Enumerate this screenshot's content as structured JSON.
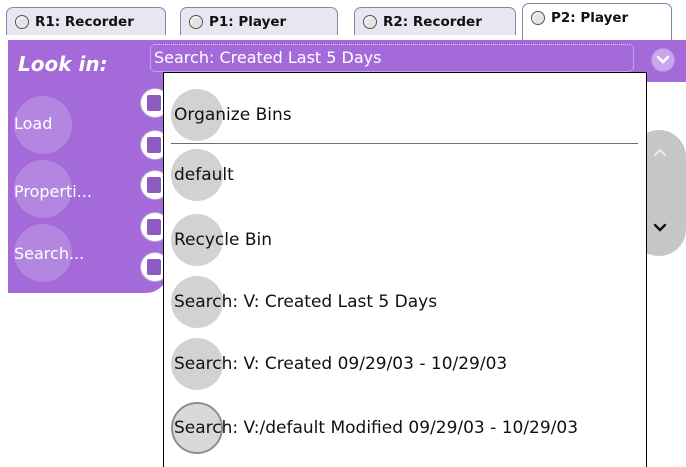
{
  "tabs": [
    {
      "label": "R1: Recorder",
      "active": false
    },
    {
      "label": "P1: Player",
      "active": false
    },
    {
      "label": "R2: Recorder",
      "active": false
    },
    {
      "label": "P2: Player",
      "active": true
    }
  ],
  "look_in": {
    "label": "Look in:",
    "value": "Search: Created Last 5 Days"
  },
  "side_buttons": [
    {
      "label": "Load"
    },
    {
      "label": "Properti..."
    },
    {
      "label": "Search..."
    }
  ],
  "dropdown": {
    "items": [
      {
        "label": "Organize Bins"
      },
      {
        "label": "default"
      },
      {
        "label": "Recycle Bin"
      },
      {
        "label": "Search: V: Created Last 5 Days"
      },
      {
        "label": "Search: V: Created 09/29/03 - 10/29/03"
      },
      {
        "label": "Search: V:/default Modified 09/29/03 - 10/29/03"
      }
    ]
  },
  "colors": {
    "panel_purple": "#a56ad9",
    "tab_background": "#e9e6f2",
    "list_bubble": "#d2d2d2"
  },
  "icons": [
    "radio-icon",
    "chevron-down-icon",
    "chevron-up-icon",
    "bin-icon"
  ]
}
